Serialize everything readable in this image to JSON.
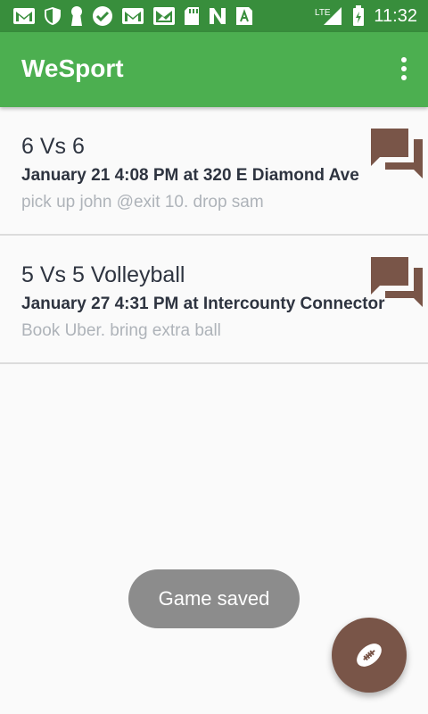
{
  "status_bar": {
    "network": "LTE",
    "time": "11:32",
    "icons": [
      "gmail-icon",
      "shield-icon",
      "keyhole-icon",
      "check-badge-icon",
      "gmail-icon",
      "photo-mail-icon",
      "sd-card-icon",
      "n-logo-icon",
      "a-app-icon"
    ]
  },
  "app_bar": {
    "title": "WeSport"
  },
  "games": [
    {
      "title": "6 Vs 6",
      "details": "January 21 4:08 PM at 320 E Diamond Ave",
      "note": "pick up john @exit 10. drop sam"
    },
    {
      "title": "5 Vs 5 Volleyball",
      "details": "January 27 4:31 PM at Intercounty Connector",
      "note": "Book Uber. bring extra ball"
    }
  ],
  "toast": "Game saved",
  "colors": {
    "status_bar": "#388e3c",
    "app_bar": "#4caf50",
    "accent": "#795548"
  }
}
